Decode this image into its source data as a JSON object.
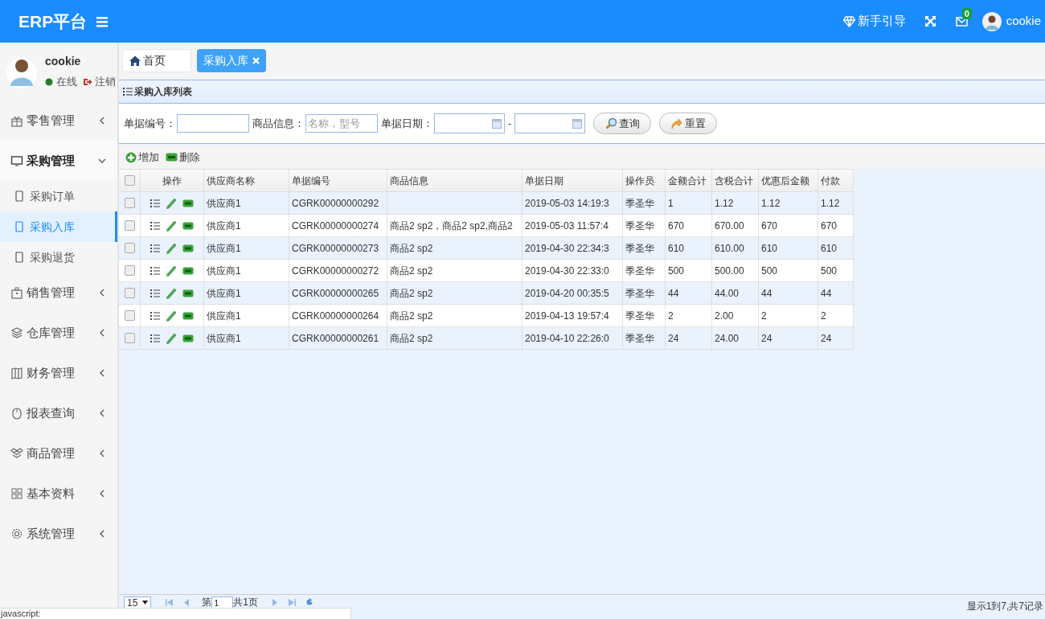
{
  "header": {
    "logo": "ERP平台",
    "guide": "新手引导",
    "mail_count": "0",
    "user": "cookie"
  },
  "profile": {
    "name": "cookie",
    "status": "在线",
    "logout": "注销"
  },
  "sidebar": {
    "items": [
      {
        "label": "零售管理",
        "expanded": false
      },
      {
        "label": "采购管理",
        "expanded": true,
        "children": [
          {
            "label": "采购订单",
            "selected": false
          },
          {
            "label": "采购入库",
            "selected": true
          },
          {
            "label": "采购退货",
            "selected": false
          }
        ]
      },
      {
        "label": "销售管理",
        "expanded": false
      },
      {
        "label": "仓库管理",
        "expanded": false
      },
      {
        "label": "财务管理",
        "expanded": false
      },
      {
        "label": "报表查询",
        "expanded": false
      },
      {
        "label": "商品管理",
        "expanded": false
      },
      {
        "label": "基本资料",
        "expanded": false
      },
      {
        "label": "系统管理",
        "expanded": false
      }
    ]
  },
  "tabs": [
    {
      "label": "首页",
      "kind": "home",
      "selected": false
    },
    {
      "label": "采购入库",
      "kind": "page",
      "selected": true
    }
  ],
  "panel_title": "采购入库列表",
  "search": {
    "fields": [
      {
        "label": "单据编号：",
        "kind": "text"
      },
      {
        "label": "商品信息：",
        "kind": "text",
        "placeholder": "名称，型号"
      },
      {
        "label": "单据日期：",
        "kind": "daterange",
        "separator": "-"
      }
    ],
    "buttons": [
      {
        "label": "查询",
        "kind": "search"
      },
      {
        "label": "重置",
        "kind": "reset"
      }
    ]
  },
  "toolbar": [
    {
      "label": "增加",
      "kind": "add"
    },
    {
      "label": "删除",
      "kind": "delete"
    }
  ],
  "table": {
    "all_checked": false,
    "actions_header": "操作",
    "columns": [
      "供应商名称",
      "单据编号",
      "商品信息",
      "单据日期",
      "操作员",
      "金额合计",
      "含税合计",
      "优惠后金额",
      "付款"
    ],
    "rows": [
      {
        "checked": false,
        "cells": [
          "供应商1",
          "CGRK00000000292",
          "",
          "2019-05-03 14:19:3",
          "季圣华",
          "1",
          "1.12",
          "1.12",
          "1.12"
        ]
      },
      {
        "checked": false,
        "cells": [
          "供应商1",
          "CGRK00000000274",
          "商品2 sp2，商品2 sp2,商品2",
          "2019-05-03 11:57:4",
          "季圣华",
          "670",
          "670.00",
          "670",
          "670"
        ]
      },
      {
        "checked": false,
        "cells": [
          "供应商1",
          "CGRK00000000273",
          "商品2 sp2",
          "2019-04-30 22:34:3",
          "季圣华",
          "610",
          "610.00",
          "610",
          "610"
        ]
      },
      {
        "checked": false,
        "cells": [
          "供应商1",
          "CGRK00000000272",
          "商品2 sp2",
          "2019-04-30 22:33:0",
          "季圣华",
          "500",
          "500.00",
          "500",
          "500"
        ]
      },
      {
        "checked": false,
        "cells": [
          "供应商1",
          "CGRK00000000265",
          "商品2 sp2",
          "2019-04-20 00:35:5",
          "季圣华",
          "44",
          "44.00",
          "44",
          "44"
        ]
      },
      {
        "checked": false,
        "cells": [
          "供应商1",
          "CGRK00000000264",
          "商品2 sp2",
          "2019-04-13 19:57:4",
          "季圣华",
          "2",
          "2.00",
          "2",
          "2"
        ]
      },
      {
        "checked": false,
        "cells": [
          "供应商1",
          "CGRK00000000261",
          "商品2 sp2",
          "2019-04-10 22:26:0",
          "季圣华",
          "24",
          "24.00",
          "24",
          "24"
        ]
      }
    ]
  },
  "pager": {
    "page_size": "15",
    "page_prefix": "第",
    "page": "1",
    "page_total": "共1页",
    "summary": "显示1到7,共7记录"
  },
  "status_popup": "javascript:"
}
